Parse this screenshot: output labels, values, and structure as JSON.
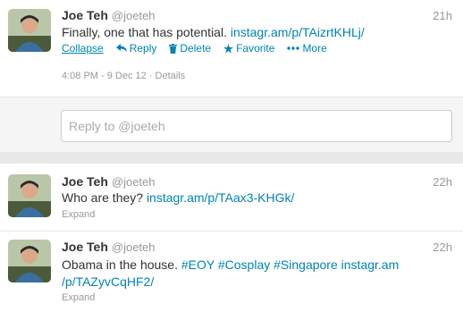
{
  "tweets": [
    {
      "name": "Joe Teh",
      "handle": "@joeteh",
      "time": "21h",
      "text": "Finally, one that has potential. ",
      "link": "instagr.am/p/TAizrtKHLj/",
      "actions": {
        "collapse": "Collapse",
        "reply": "Reply",
        "delete": "Delete",
        "favorite": "Favorite",
        "more": "More"
      },
      "meta": "4:08 PM - 9 Dec 12 · Details"
    },
    {
      "name": "Joe Teh",
      "handle": "@joeteh",
      "time": "22h",
      "text": "Who are they? ",
      "link": "instagr.am/p/TAax3-KHGk/",
      "expand": "Expand"
    },
    {
      "name": "Joe Teh",
      "handle": "@joeteh",
      "time": "22h",
      "text": "Obama in the house. ",
      "hashtags": [
        "#EOY",
        "#Cosplay",
        "#Singapore"
      ],
      "link_line1": "instagr.am",
      "link_line2": "/p/TAZyvCqHF2/",
      "expand": "Expand"
    }
  ],
  "reply_box": {
    "placeholder": "Reply to @joeteh"
  },
  "colors": {
    "link": "#0084b4",
    "muted": "#999999",
    "text": "#333333"
  },
  "icons": [
    "reply-icon",
    "trash-icon",
    "star-icon",
    "more-dots-icon"
  ]
}
